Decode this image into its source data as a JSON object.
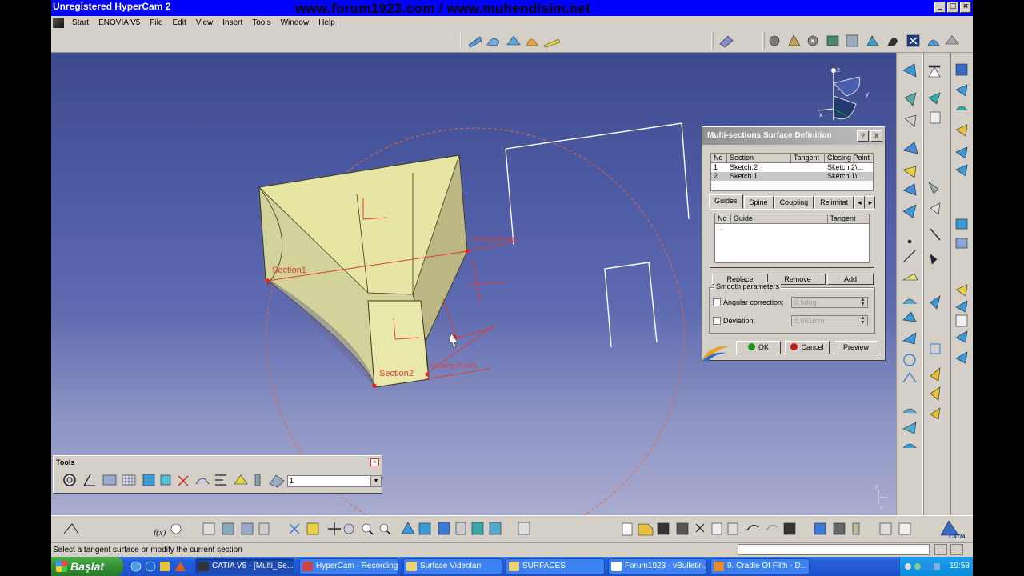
{
  "window": {
    "app_title": "Unregistered HyperCam 2",
    "watermark": "www.forum1923.com / www.muhendisim.net"
  },
  "menubar": {
    "items": [
      "Start",
      "ENOVIA V5",
      "File",
      "Edit",
      "View",
      "Insert",
      "Tools",
      "Window",
      "Help"
    ]
  },
  "viewport": {
    "labels": {
      "section1": "Section1",
      "section2": "Section2",
      "closing_point1": "Closing Point1",
      "closing_point2": "Closing Point2"
    },
    "compass_axes": {
      "z": "z",
      "y": "y",
      "x": "x"
    },
    "mini_axes": {
      "y": "y",
      "x": "x"
    }
  },
  "dialog": {
    "title": "Multi-sections Surface Definition",
    "help_button": "?",
    "close_button": "X",
    "sections_table": {
      "columns": [
        "No",
        "Section",
        "Tangent",
        "Closing Point"
      ],
      "rows": [
        {
          "no": "1",
          "section": "Sketch.2",
          "tangent": "",
          "closing_point": "Sketch.2\\..."
        },
        {
          "no": "2",
          "section": "Sketch.1",
          "tangent": "",
          "closing_point": "Sketch.1\\..."
        }
      ]
    },
    "tabs": [
      "Guides",
      "Spine",
      "Coupling",
      "Relimitat"
    ],
    "guides_table": {
      "columns": [
        "No",
        "Guide",
        "Tangent"
      ],
      "rows": [
        {
          "no": "...",
          "guide": "",
          "tangent": ""
        }
      ]
    },
    "replace_button": "Replace",
    "remove_button": "Remove",
    "add_button": "Add",
    "smooth_group": "Smooth parameters",
    "angular_correction": {
      "label": "Angular correction:",
      "value": "0.5deg",
      "checked": false
    },
    "deviation": {
      "label": "Deviation:",
      "value": "0.001mm",
      "checked": false
    },
    "ok_button": "OK",
    "cancel_button": "Cancel",
    "preview_button": "Preview"
  },
  "tools_panel": {
    "title": "Tools",
    "combo_value": "1"
  },
  "statusbar": {
    "text": "Select a tangent surface or modify the current section"
  },
  "taskbar": {
    "start_label": "Başlat",
    "tasks": [
      "CATIA V5 - [Multi_Se...",
      "HyperCam - Recording",
      "Surface Videoları",
      "SURFACES",
      "Forum1923 - vBulletin...",
      "9. Cradle Of Filth - D..."
    ],
    "clock": "19:58"
  },
  "colors": {
    "title_blue": "#0000ff",
    "surface_fill": "#e8e7a6",
    "annotation_red": "#e23c2c",
    "ok_green": "#1a9a1a",
    "cancel_red": "#c81818"
  }
}
